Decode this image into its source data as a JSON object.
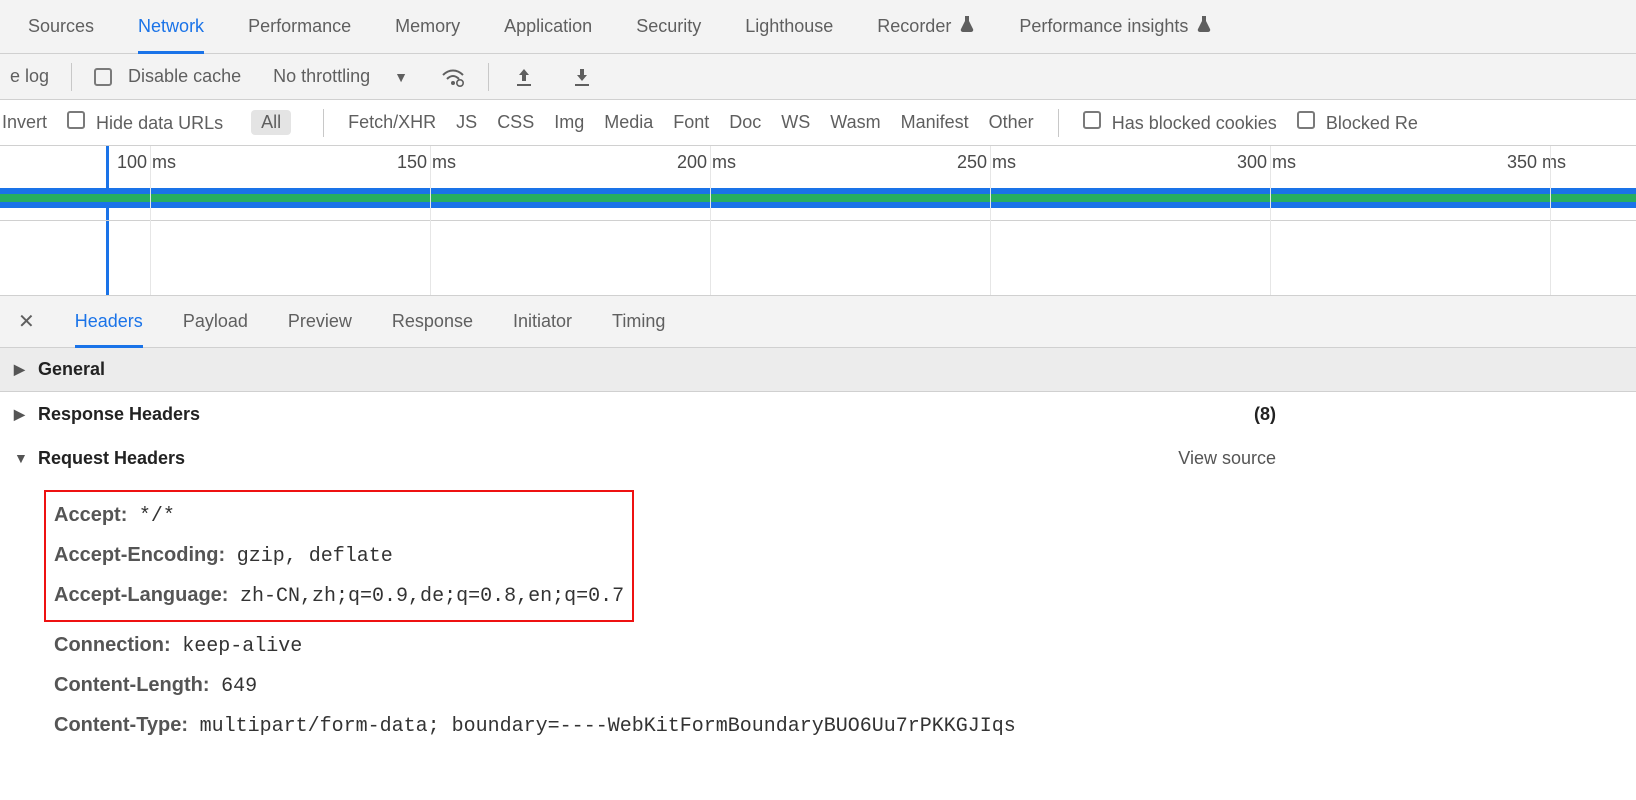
{
  "top_tabs": {
    "sources": "Sources",
    "network": "Network",
    "performance": "Performance",
    "memory": "Memory",
    "application": "Application",
    "security": "Security",
    "lighthouse": "Lighthouse",
    "recorder": "Recorder",
    "perf_insights": "Performance insights"
  },
  "toolbar": {
    "log_fragment": "e log",
    "disable_cache": "Disable cache",
    "throttling": "No throttling"
  },
  "filters": {
    "invert": "Invert",
    "hide_data_urls": "Hide data URLs",
    "all": "All",
    "fetch_xhr": "Fetch/XHR",
    "js": "JS",
    "css": "CSS",
    "img": "Img",
    "media": "Media",
    "font": "Font",
    "doc": "Doc",
    "ws": "WS",
    "wasm": "Wasm",
    "manifest": "Manifest",
    "other": "Other",
    "has_blocked_cookies": "Has blocked cookies",
    "blocked_req": "Blocked Re"
  },
  "timeline_ticks": [
    "100 ms",
    "150 ms",
    "200 ms",
    "250 ms",
    "300 ms",
    "350 ms"
  ],
  "details_tabs": {
    "headers": "Headers",
    "payload": "Payload",
    "preview": "Preview",
    "response": "Response",
    "initiator": "Initiator",
    "timing": "Timing"
  },
  "sections": {
    "general": "General",
    "response_headers": "Response Headers",
    "response_count": "(8)",
    "request_headers": "Request Headers",
    "view_source": "View source"
  },
  "request_headers": [
    {
      "name": "Accept:",
      "value": "*/*",
      "hl": true
    },
    {
      "name": "Accept-Encoding:",
      "value": "gzip, deflate",
      "hl": true
    },
    {
      "name": "Accept-Language:",
      "value": "zh-CN,zh;q=0.9,de;q=0.8,en;q=0.7",
      "hl": true
    },
    {
      "name": "Connection:",
      "value": "keep-alive",
      "hl": false
    },
    {
      "name": "Content-Length:",
      "value": "649",
      "hl": false
    },
    {
      "name": "Content-Type:",
      "value": "multipart/form-data; boundary=----WebKitFormBoundaryBUO6Uu7rPKKGJIqs",
      "hl": false
    }
  ]
}
